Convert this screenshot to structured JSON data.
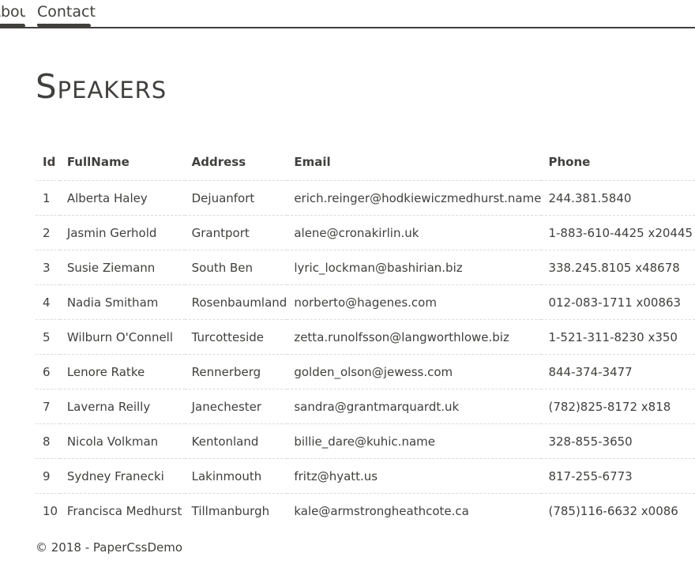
{
  "nav": {
    "items": [
      {
        "label": "About"
      },
      {
        "label": "Contact"
      }
    ]
  },
  "page": {
    "title": "Speakers"
  },
  "table": {
    "headers": [
      "Id",
      "FullName",
      "Address",
      "Email",
      "Phone"
    ],
    "rows": [
      [
        "1",
        "Alberta Haley",
        "Dejuanfort",
        "erich.reinger@hodkiewiczmedhurst.name",
        "244.381.5840"
      ],
      [
        "2",
        "Jasmin Gerhold",
        "Grantport",
        "alene@cronakirlin.uk",
        "1-883-610-4425 x20445"
      ],
      [
        "3",
        "Susie Ziemann",
        "South Ben",
        "lyric_lockman@bashirian.biz",
        "338.245.8105 x48678"
      ],
      [
        "4",
        "Nadia Smitham",
        "Rosenbaumland",
        "norberto@hagenes.com",
        "012-083-1711 x00863"
      ],
      [
        "5",
        "Wilburn O'Connell",
        "Turcotteside",
        "zetta.runolfsson@langworthlowe.biz",
        "1-521-311-8230 x350"
      ],
      [
        "6",
        "Lenore Ratke",
        "Rennerberg",
        "golden_olson@jewess.com",
        "844-374-3477"
      ],
      [
        "7",
        "Laverna Reilly",
        "Janechester",
        "sandra@grantmarquardt.uk",
        "(782)825-8172 x818"
      ],
      [
        "8",
        "Nicola Volkman",
        "Kentonland",
        "billie_dare@kuhic.name",
        "328-855-3650"
      ],
      [
        "9",
        "Sydney Franecki",
        "Lakinmouth",
        "fritz@hyatt.us",
        "817-255-6773"
      ],
      [
        "10",
        "Francisca Medhurst",
        "Tillmanburgh",
        "kale@armstrongheathcote.ca",
        "(785)116-6632 x0086"
      ]
    ]
  },
  "footer": {
    "text": "© 2018 - PaperCssDemo"
  }
}
